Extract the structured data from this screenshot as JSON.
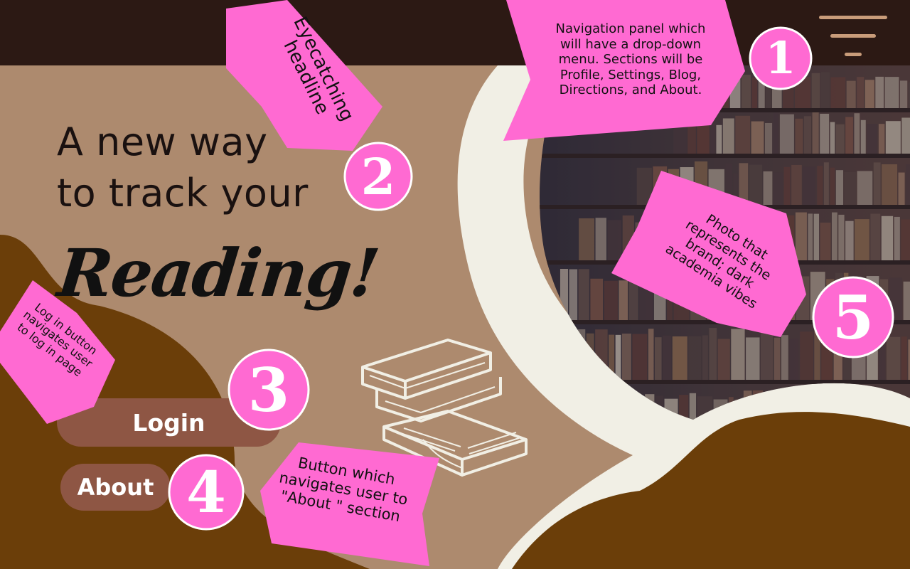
{
  "headline": {
    "line1": "A new way",
    "line2": "to track your",
    "emphasis": "Reading!"
  },
  "buttons": {
    "login_label": "Login",
    "about_label": "About"
  },
  "annotations": {
    "nav_note": [
      "Navigation panel which",
      "will have a drop-down",
      "menu. Sections will be",
      "Profile, Settings, Blog,",
      "Directions, and About."
    ],
    "headline_note": [
      "Eyecatching",
      "headline"
    ],
    "login_note": [
      "Log in button",
      "navigates user",
      "to log in page"
    ],
    "about_note": [
      "Button which",
      "navigates user to",
      "\"About \" section"
    ],
    "photo_note": [
      "Photo that",
      "represents the",
      "brand; dark",
      "academia vibes"
    ]
  },
  "markers": {
    "nav": "1",
    "headline": "2",
    "login": "3",
    "about": "4",
    "photo": "5"
  },
  "icons": {
    "menu": "hamburger-menu-icon",
    "books": "stacked-books-illustration",
    "photo": "library-bookshelf-photo"
  },
  "colors": {
    "top_bar": "#2c1914",
    "background": "#ad8a6e",
    "dark_brown": "#6b3e09",
    "cream": "#f1efe5",
    "button": "#8e5644",
    "annotation_pink": "#ff6ad2",
    "menu_lines": "#c99c7a"
  }
}
